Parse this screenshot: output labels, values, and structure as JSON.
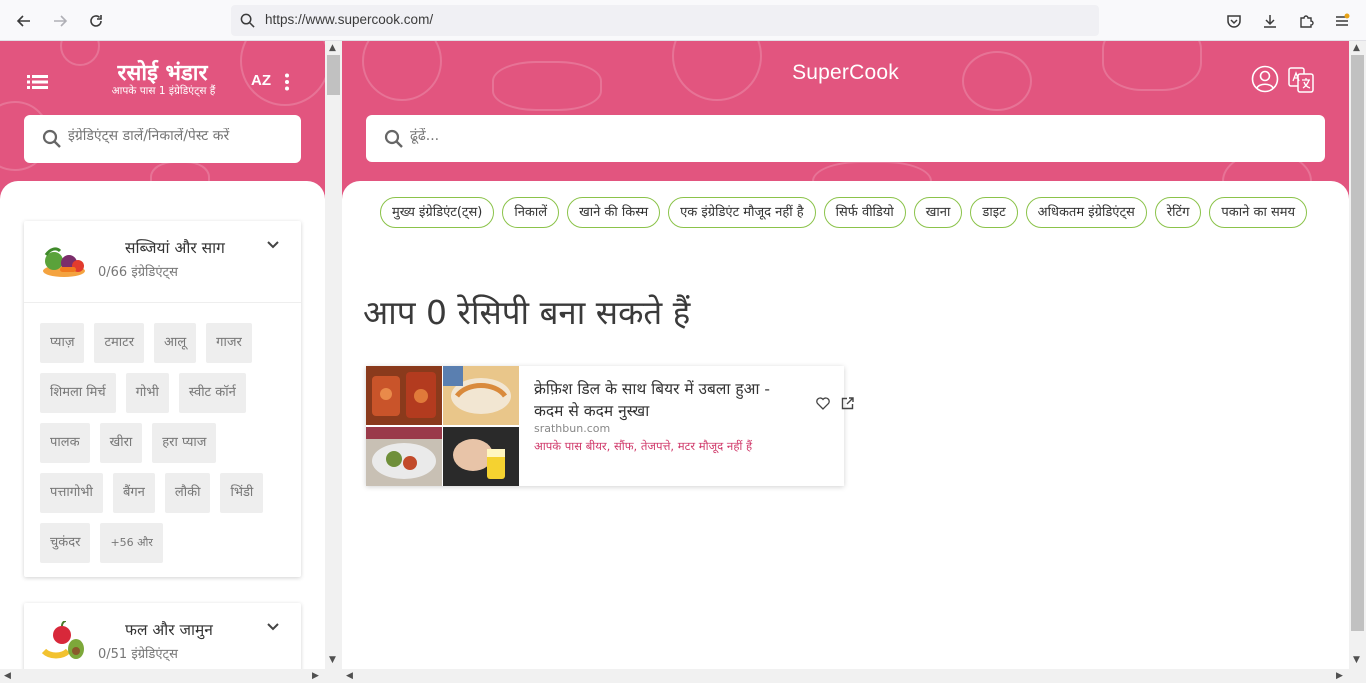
{
  "browser": {
    "url": "https://www.supercook.com/"
  },
  "pantry": {
    "title": "रसोई भंडार",
    "subtitle": "आपके पास 1 इंग्रेडिएंट्स हैं",
    "sort_label": "AZ",
    "search_placeholder": "इंग्रेडिएंट्स डालें/निकालें/पेस्ट करें",
    "categories": [
      {
        "title": "सब्जियां और साग",
        "count": "0/66 इंग्रेडिएंट्स",
        "icon": "vegetables-icon",
        "items": [
          "प्याज़",
          "टमाटर",
          "आलू",
          "गाजर",
          "शिमला मिर्च",
          "गोभी",
          "स्वीट कॉर्न",
          "पालक",
          "खीरा",
          "हरा प्याज",
          "पत्तागोभी",
          "बैंगन",
          "लौकी",
          "भिंडी",
          "चुकंदर"
        ],
        "more": "+56 और"
      },
      {
        "title": "फल और जामुन",
        "count": "0/51 इंग्रेडिएंट्स",
        "icon": "fruits-icon"
      }
    ]
  },
  "main": {
    "brand": "SuperCook",
    "search_placeholder": "ढूंढें...",
    "filters": [
      "मुख्य इंग्रेडिएंट(ट्स)",
      "निकालें",
      "खाने की किस्म",
      "एक इंग्रेडिएंट मौजूद नहीं है",
      "सिर्फ वीडियो",
      "खाना",
      "डाइट",
      "अधिकतम इंग्रेडिएंट्स",
      "रेटिंग",
      "पकाने का समय"
    ],
    "result_heading": "आप 0 रेसिपी बना सकते हैं",
    "recipe": {
      "title": "क्रेफ़िश डिल के साथ बियर में उबला हुआ - कदम से कदम नुस्खा",
      "source": "srathbun.com",
      "missing": "आपके पास बीयर, सौंफ, तेजपत्ते, मटर मौजूद नहीं हैं"
    }
  },
  "colors": {
    "brand_pink": "#e2557f",
    "filter_border": "#8bc34a",
    "missing_text": "#d0396a"
  }
}
